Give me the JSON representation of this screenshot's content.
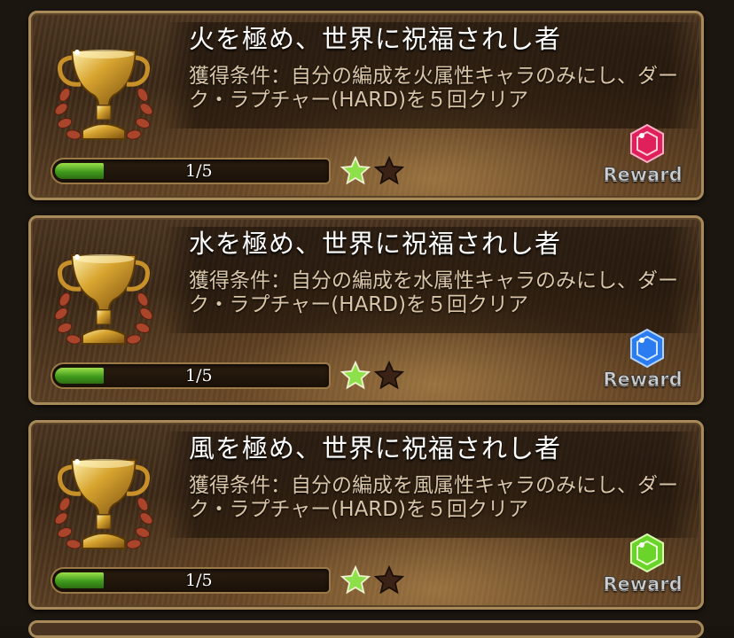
{
  "trophies": [
    {
      "title": "火を極め、世界に祝福されし者",
      "condition": "獲得条件：自分の編成を火属性キャラのみにし、ダーク・ラプチャー(HARD)を５回クリア",
      "progress_text": "1/5",
      "progress": 0.2,
      "stars_lit": 1,
      "stars_total": 2,
      "reward_label": "Reward",
      "gem_color": "#e0205a",
      "gem_name": "fire-gem-icon"
    },
    {
      "title": "水を極め、世界に祝福されし者",
      "condition": "獲得条件：自分の編成を水属性キャラのみにし、ダーク・ラプチャー(HARD)を５回クリア",
      "progress_text": "1/5",
      "progress": 0.2,
      "stars_lit": 1,
      "stars_total": 2,
      "reward_label": "Reward",
      "gem_color": "#2a7cf0",
      "gem_name": "water-gem-icon"
    },
    {
      "title": "風を極め、世界に祝福されし者",
      "condition": "獲得条件：自分の編成を風属性キャラのみにし、ダーク・ラプチャー(HARD)を５回クリア",
      "progress_text": "1/5",
      "progress": 0.2,
      "stars_lit": 1,
      "stars_total": 2,
      "reward_label": "Reward",
      "gem_color": "#6ad42a",
      "gem_name": "wind-gem-icon"
    }
  ],
  "colors": {
    "frame": "#a88a5a",
    "bar_fill": "#5fbf2a",
    "star_lit": "#8ee04a",
    "star_dim": "#3a2216"
  }
}
